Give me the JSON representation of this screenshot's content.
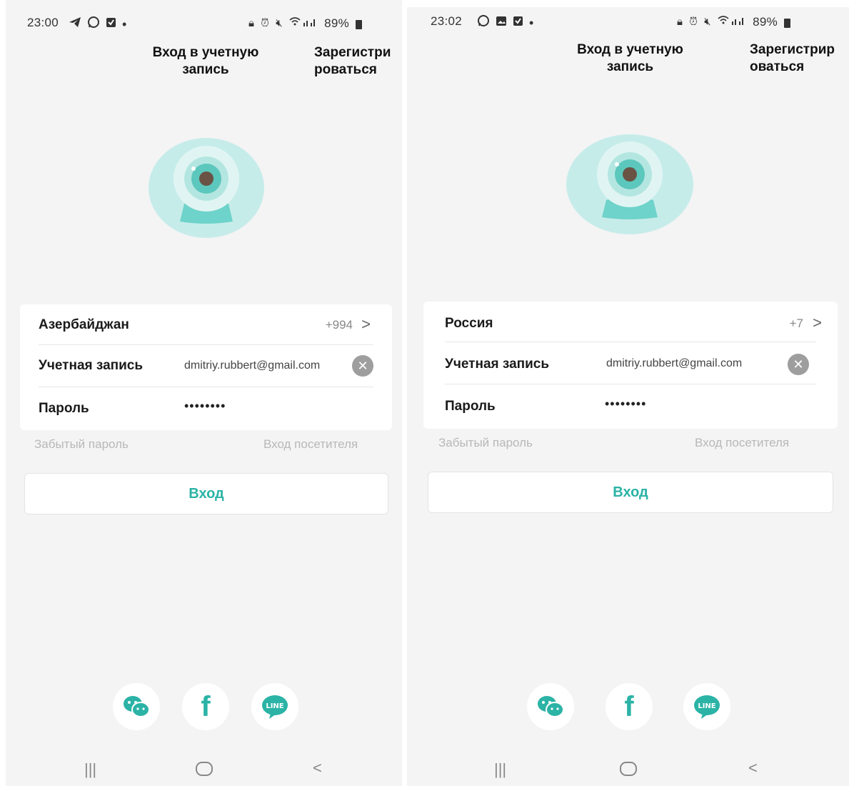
{
  "colors": {
    "accent": "#2bb3a6",
    "background": "#f4f4f4",
    "muted": "#b8b8b8"
  },
  "screens": [
    {
      "status": {
        "time": "23:00",
        "left_icons": [
          "telegram-icon",
          "whatsapp-icon",
          "checkbox-icon"
        ],
        "battery": "89%"
      },
      "header": {
        "login_title": "Вход в учетную запись",
        "register_label": "Зарегистрироваться"
      },
      "form": {
        "country": "Азербайджан",
        "country_code": "+994",
        "account_label": "Учетная запись",
        "account_value": "dmitriy.rubbert@gmail.com",
        "password_label": "Пароль",
        "password_value": "••••••••"
      },
      "forgot_password": "Забытый пароль",
      "guest_login": "Вход посетителя",
      "login_button": "Вход",
      "social": [
        "wechat-icon",
        "facebook-icon",
        "line-icon"
      ]
    },
    {
      "status": {
        "time": "23:02",
        "left_icons": [
          "whatsapp-icon",
          "image-icon",
          "checkbox-icon"
        ],
        "battery": "89%"
      },
      "header": {
        "login_title": "Вход в учетную запись",
        "register_label": "Зарегистрироваться"
      },
      "form": {
        "country": "Россия",
        "country_code": "+7",
        "account_label": "Учетная запись",
        "account_value": "dmitriy.rubbert@gmail.com",
        "password_label": "Пароль",
        "password_value": "••••••••"
      },
      "forgot_password": "Забытый пароль",
      "guest_login": "Вход посетителя",
      "login_button": "Вход",
      "social": [
        "wechat-icon",
        "facebook-icon",
        "line-icon"
      ]
    }
  ]
}
